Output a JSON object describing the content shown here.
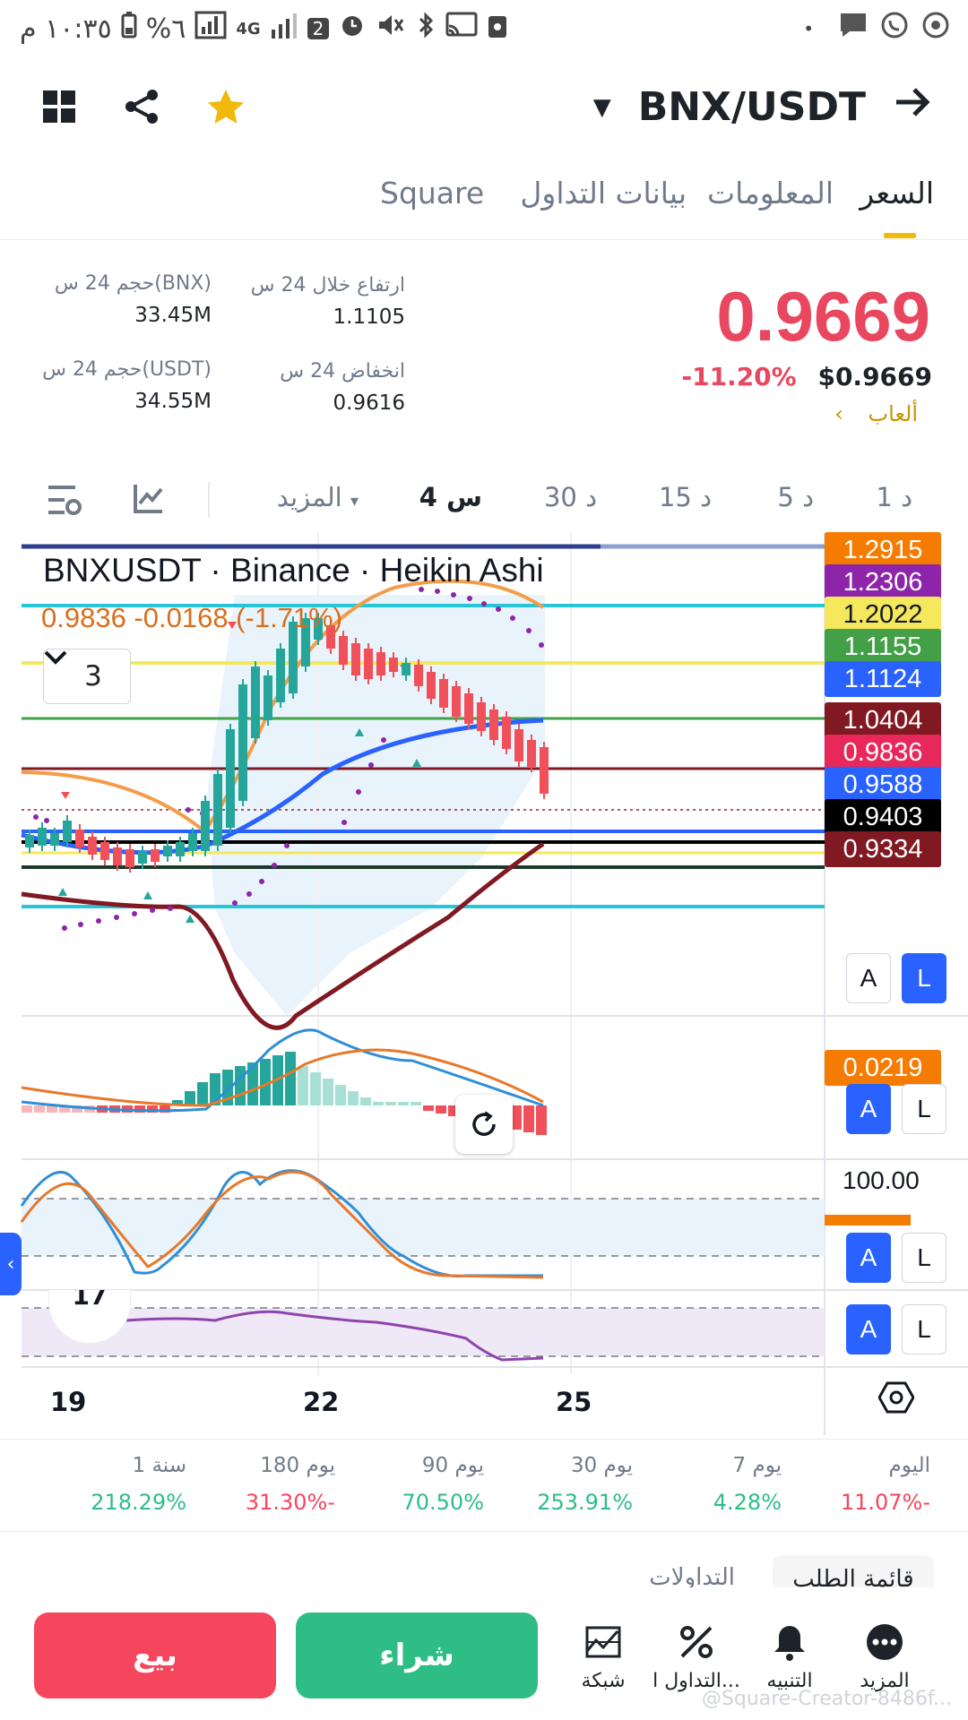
{
  "status_bar": {
    "time": "١٠:٣٥ م",
    "battery": "%٦",
    "network": "4G",
    "sim": "2"
  },
  "header": {
    "pair": "BNX/USDT"
  },
  "tabs": [
    "السعر",
    "المعلومات",
    "بيانات التداول",
    "Square"
  ],
  "ticker": {
    "last_price": "0.9669",
    "usd_price": "$0.9669",
    "change_pct": "-11.20%",
    "tag": "ألعاب",
    "high_label": "ارتفاع خلال 24 س",
    "high_value": "1.1105",
    "low_label": "انخفاض 24 س",
    "low_value": "0.9616",
    "vol_bnx_label": "حجم 24 س(BNX)",
    "vol_bnx_value": "33.45M",
    "vol_usdt_label": "حجم 24 س(USDT)",
    "vol_usdt_value": "34.55M"
  },
  "intervals": [
    "1 د",
    "5 د",
    "15 د",
    "30 د",
    "4 س",
    "المزيد"
  ],
  "chart": {
    "title": "BNXUSDT · Binance · Heikin Ashi",
    "ohlc_line": "0.9836  -0.0168 (-1.71%)",
    "indicator_count": "3",
    "macd_value": "0.0219",
    "stoch_top": "100.00",
    "price_labels": [
      {
        "value": "1.2915",
        "color": "#f57c00"
      },
      {
        "value": "1.2306",
        "color": "#8e24aa"
      },
      {
        "value": "1.2022",
        "color": "#f5e85c"
      },
      {
        "value": "1.1155",
        "color": "#43a047"
      },
      {
        "value": "1.1124",
        "color": "#2962ff"
      },
      {
        "value": "1.0404",
        "color": "#801922"
      },
      {
        "value": "0.9836",
        "color": "#e8275a"
      },
      {
        "value": "0.9588",
        "color": "#2962ff"
      },
      {
        "value": "0.9403",
        "color": "#000000"
      },
      {
        "value": "0.9334",
        "color": "#801922"
      }
    ],
    "x_labels": [
      "19",
      "22",
      "25"
    ],
    "btn_a": "A",
    "btn_l": "L",
    "side_tab": "‹",
    "partial_value": "17"
  },
  "performance": [
    {
      "label": "اليوم",
      "value": "11.07%-",
      "sign": "neg"
    },
    {
      "label": "7 يوم",
      "value": "4.28%",
      "sign": "pos"
    },
    {
      "label": "30 يوم",
      "value": "253.91%",
      "sign": "pos"
    },
    {
      "label": "90 يوم",
      "value": "70.50%",
      "sign": "pos"
    },
    {
      "label": "180 يوم",
      "value": "31.30%-",
      "sign": "neg"
    },
    {
      "label": "1 سنة",
      "value": "218.29%",
      "sign": "pos"
    }
  ],
  "lower_tabs": {
    "order_book": "قائمة الطلب",
    "trades": "التداولات"
  },
  "bottom_nav": {
    "more": "المزيد",
    "alert": "التنبيه",
    "trading": "التداول ا...",
    "grid": "شبكة",
    "buy": "شراء",
    "sell": "بيع"
  },
  "watermark": "@Square-Creator-8486f...",
  "colors": {
    "up": "#2ebd85",
    "down": "#f6465d",
    "accent": "#f0b90b",
    "tv_blue": "#2962ff"
  }
}
